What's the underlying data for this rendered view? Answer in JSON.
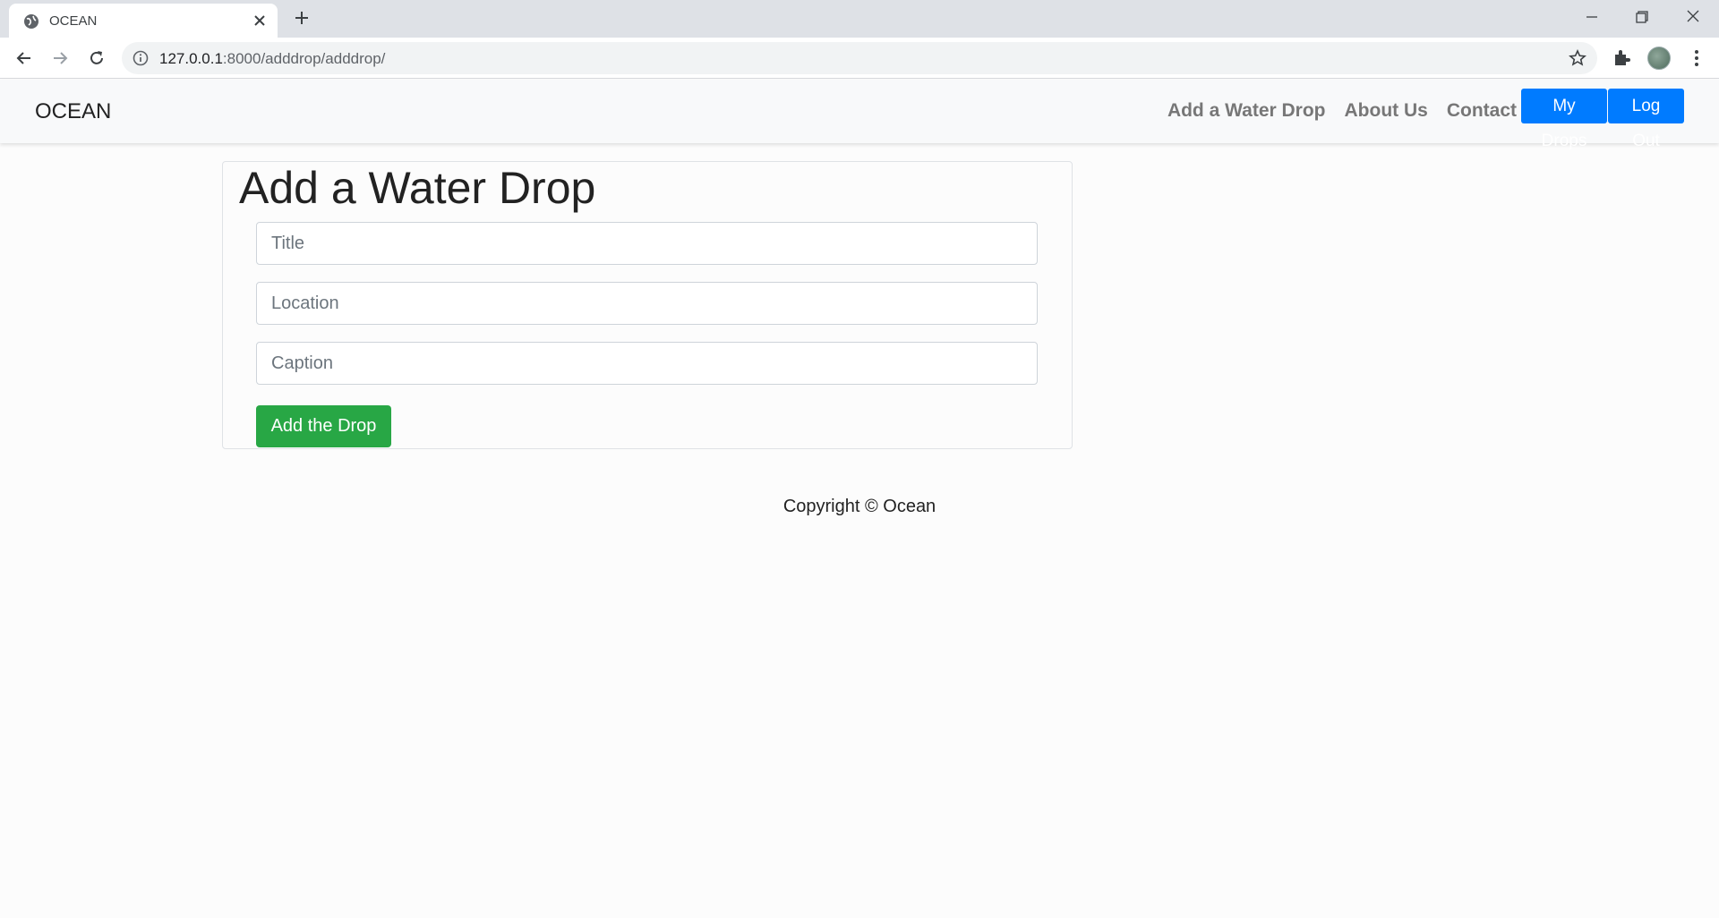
{
  "browser": {
    "tab_title": "OCEAN",
    "url_host": "127.0.0.1",
    "url_rest": ":8000/adddrop/adddrop/"
  },
  "site": {
    "brand": "OCEAN",
    "nav_links": [
      "Add a Water Drop",
      "About Us",
      "Contact"
    ],
    "my_drops_label": "My Drops",
    "logout_label": "Log Out"
  },
  "form": {
    "heading": "Add a Water Drop",
    "title_placeholder": "Title",
    "location_placeholder": "Location",
    "caption_placeholder": "Caption",
    "submit_label": "Add the Drop"
  },
  "footer": {
    "text": "Copyright © Ocean"
  },
  "colors": {
    "primary": "#007bff",
    "success": "#28a745",
    "navbar_bg": "#f8f9fa"
  }
}
